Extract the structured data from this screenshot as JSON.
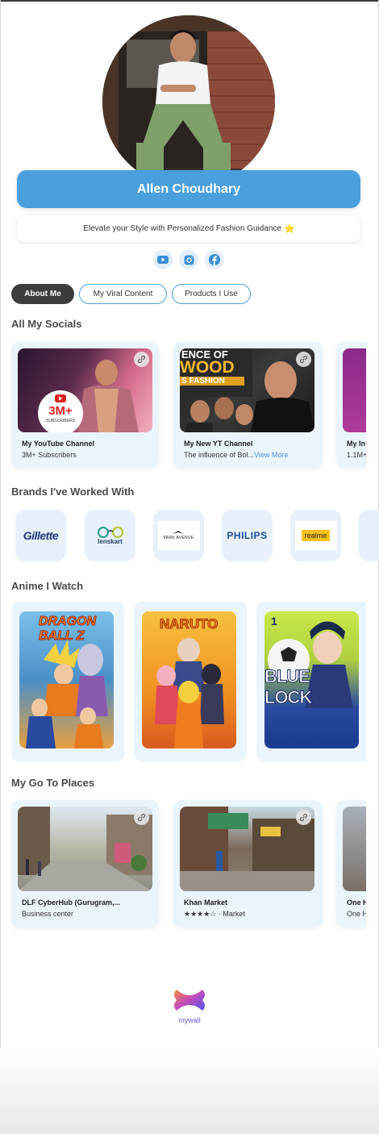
{
  "profile": {
    "name": "Allen Choudhary",
    "tagline": "Elevate your Style with Personalized Fashion Guidance",
    "tagline_emoji": "⭐"
  },
  "social_icons": [
    "youtube-icon",
    "instagram-icon",
    "facebook-icon"
  ],
  "tabs": [
    {
      "label": "About Me",
      "active": true
    },
    {
      "label": "My Viral Content",
      "active": false
    },
    {
      "label": "Products I Use",
      "active": false
    }
  ],
  "sections": {
    "socials": "All My Socials",
    "brands": "Brands I've Worked With",
    "anime": "Anime I Watch",
    "places": "My Go To Places"
  },
  "socials": [
    {
      "title": "My YouTube Channel",
      "subtitle": "3M+ Subscribers",
      "badge": "3M+",
      "badge_sub": "SUBSCRIBERS"
    },
    {
      "title": "My New YT Channel",
      "subtitle": "The influence of Bol...",
      "more": "View More",
      "thumb_text_1": "ENCE OF",
      "thumb_text_2": "WOOD",
      "thumb_text_3": "S FASHION"
    },
    {
      "title": "My In",
      "subtitle": "1.1M+"
    }
  ],
  "brands": [
    {
      "name": "Gillette"
    },
    {
      "name": "lenskart"
    },
    {
      "name": "PARK AVENUE"
    },
    {
      "name": "PHILIPS"
    },
    {
      "name": "realme"
    }
  ],
  "anime": [
    {
      "title": "DRAGON BALL Z"
    },
    {
      "title": "NARUTO"
    },
    {
      "title": "BLUE LOCK",
      "number": "1"
    }
  ],
  "places": [
    {
      "title": "DLF CyberHub (Gurugram,...",
      "subtitle": "Business center"
    },
    {
      "title": "Khan Market",
      "subtitle": "★★★★☆ · Market"
    },
    {
      "title": "One H",
      "subtitle": "One H"
    }
  ],
  "footer": {
    "brand": "mywall"
  },
  "colors": {
    "accent": "#4a9fdd",
    "card_bg": "#eaf4fc",
    "tab_active": "#3c3c3c"
  }
}
